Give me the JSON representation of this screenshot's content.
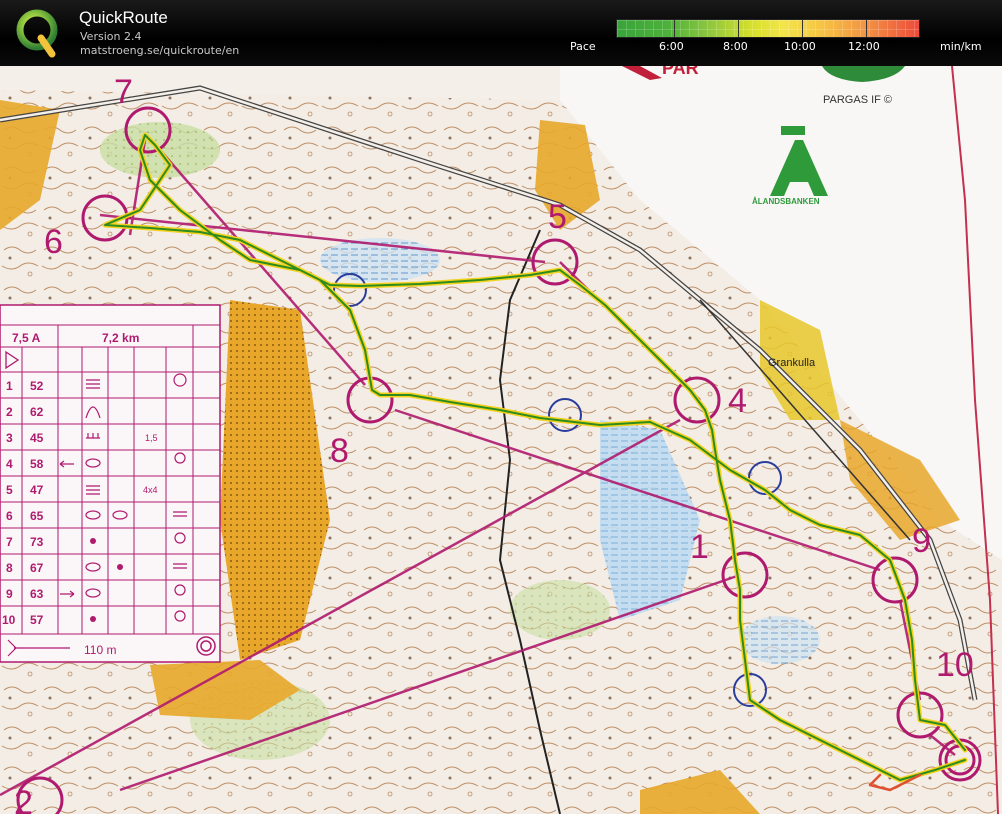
{
  "app": {
    "title": "QuickRoute",
    "version": "Version 2.4",
    "url": "matstroeng.se/quickroute/en"
  },
  "pace_scale": {
    "label": "Pace",
    "unit": "min/km",
    "ticks": [
      "6:00",
      "8:00",
      "10:00",
      "12:00"
    ]
  },
  "map": {
    "club_text": "PARGAS IF ©",
    "brand_text": "ÅLANDSBANKEN",
    "place_name": "Grankulla",
    "controls": [
      "1",
      "4",
      "5",
      "6",
      "7",
      "8",
      "9",
      "10",
      "2"
    ],
    "legend": {
      "class_label": "7,5 A",
      "distance": "7,2 km",
      "rows": [
        {
          "num": "1",
          "code": "52",
          "extra": ""
        },
        {
          "num": "2",
          "code": "62",
          "extra": ""
        },
        {
          "num": "3",
          "code": "45",
          "extra": "1,5"
        },
        {
          "num": "4",
          "code": "58",
          "extra": ""
        },
        {
          "num": "5",
          "code": "47",
          "extra": "4x4"
        },
        {
          "num": "6",
          "code": "65",
          "extra": ""
        },
        {
          "num": "7",
          "code": "73",
          "extra": ""
        },
        {
          "num": "8",
          "code": "67",
          "extra": ""
        },
        {
          "num": "9",
          "code": "63",
          "extra": ""
        },
        {
          "num": "10",
          "code": "57",
          "extra": ""
        }
      ],
      "finish": "110 m"
    }
  },
  "colors": {
    "course": "#b01a6e",
    "route_green": "#2e8b1e",
    "route_yellow": "#f2d21c",
    "open_land": "#e8a72a",
    "header_bg": "#000000"
  }
}
